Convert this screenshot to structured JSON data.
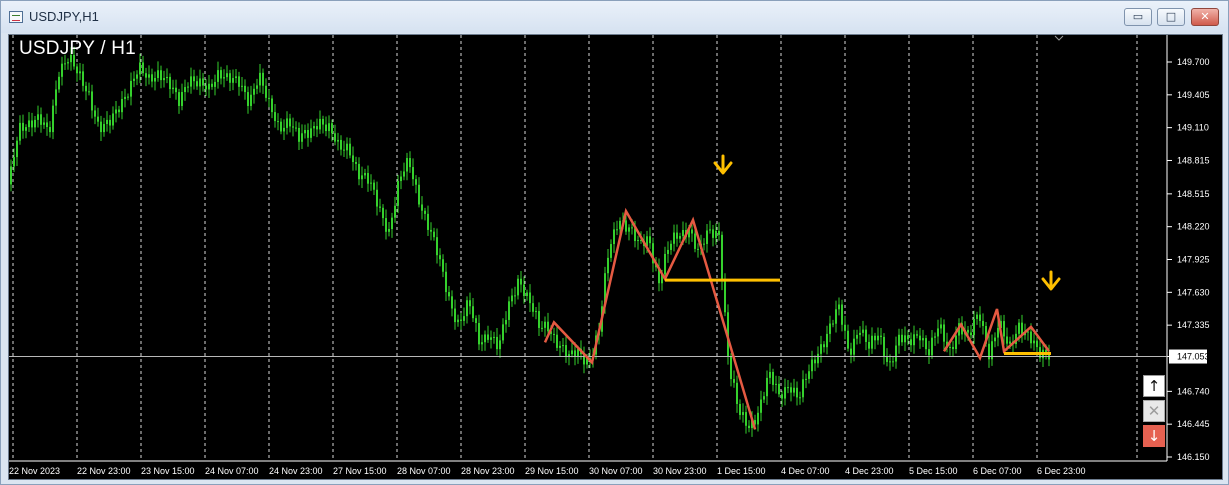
{
  "window": {
    "title": "USDJPY,H1",
    "minimize_label": "▭",
    "maximize_label": "□",
    "close_label": "✕"
  },
  "chart": {
    "symbol_title": "USDJPY / H1",
    "current_price": "147.053",
    "colors": {
      "background": "#000000",
      "candles": "#35d12d",
      "grid": "#ffffff",
      "zigzag": "#e55a42",
      "support_lines": "#ffc000",
      "arrows": "#ffc000",
      "axis_text": "#ffffff",
      "price_line": "#b8b8b8"
    }
  },
  "side_controls": {
    "buy_icon": "↑",
    "close_icon": "✕",
    "sell_icon": "↓"
  },
  "chart_data": {
    "type": "candlestick",
    "title": "USDJPY / H1",
    "x_labels": [
      "22 Nov 2023",
      "22 Nov 23:00",
      "23 Nov 15:00",
      "24 Nov 07:00",
      "24 Nov 23:00",
      "27 Nov 15:00",
      "28 Nov 07:00",
      "28 Nov 23:00",
      "29 Nov 15:00",
      "30 Nov 07:00",
      "30 Nov 23:00",
      "1 Dec 15:00",
      "4 Dec 07:00",
      "4 Dec 23:00",
      "5 Dec 15:00",
      "6 Dec 07:00",
      "6 Dec 23:00"
    ],
    "y_ticks": [
      "149.700",
      "149.405",
      "149.110",
      "148.815",
      "148.515",
      "148.220",
      "147.925",
      "147.630",
      "147.335",
      "147.053",
      "146.740",
      "146.445",
      "146.150"
    ],
    "y_range": [
      146.15,
      149.7
    ],
    "current_price": 147.053,
    "zigzag_prices": [
      147.18,
      147.36,
      147.0,
      148.36,
      147.75,
      148.28,
      146.4
    ],
    "zigzag_prices_right": [
      147.1,
      147.34,
      147.04,
      147.48,
      147.1,
      147.32,
      147.1
    ],
    "horizontal_levels": [
      147.74,
      147.08
    ],
    "arrows": [
      "↓",
      "↓"
    ]
  }
}
